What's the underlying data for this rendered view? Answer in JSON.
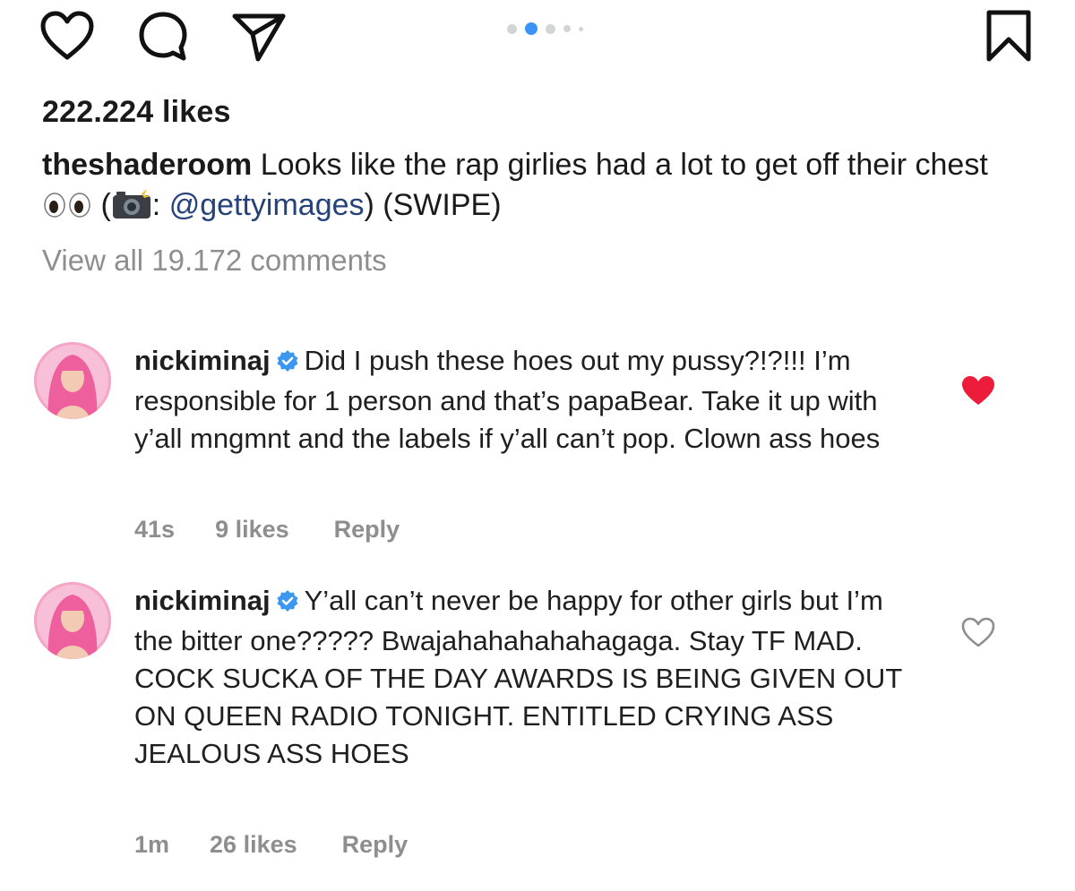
{
  "post": {
    "likes_text": "222.224 likes",
    "caption_user": "theshaderoom",
    "caption_text_1": "Looks like the rap girlies had a lot to get off their chest",
    "caption_paren_open": " (",
    "caption_colon": ": ",
    "caption_mention": "@gettyimages",
    "caption_tail": ") (SWIPE)",
    "view_all_text": "View all 19.172 comments",
    "carousel": {
      "dot_count": 5,
      "active_index": 1
    }
  },
  "icons": {
    "like": "heart-outline-icon",
    "comment": "speech-bubble-icon",
    "share": "paper-plane-icon",
    "save": "bookmark-icon",
    "verified": "verified-badge-icon"
  },
  "colors": {
    "text": "#1a1a1a",
    "muted": "#8e8e8e",
    "mention": "#26427a",
    "liked_heart": "#ed1c3a",
    "carousel_active": "#3b93f7",
    "verified_blue": "#3b97f0"
  },
  "comments": [
    {
      "username": "nickiminaj",
      "text": "Did I push these hoes out my pussy?!?!!! I’m responsible for 1 person and that’s papaBear. Take it up with y’all mngmnt and the labels if y’all can’t pop. Clown ass hoes",
      "time": "41s",
      "likes": "9 likes",
      "reply_label": "Reply",
      "liked": true
    },
    {
      "username": "nickiminaj",
      "text": "Y’all can’t never be happy for other girls but I’m the bitter one????? Bwajahahahahahagaga. Stay TF MAD. COCK SUCKA OF THE DAY AWARDS IS BEING GIVEN OUT ON QUEEN RADIO TONIGHT. ENTITLED CRYING ASS JEALOUS ASS HOES",
      "time": "1m",
      "likes": "26 likes",
      "reply_label": "Reply",
      "liked": false
    }
  ]
}
